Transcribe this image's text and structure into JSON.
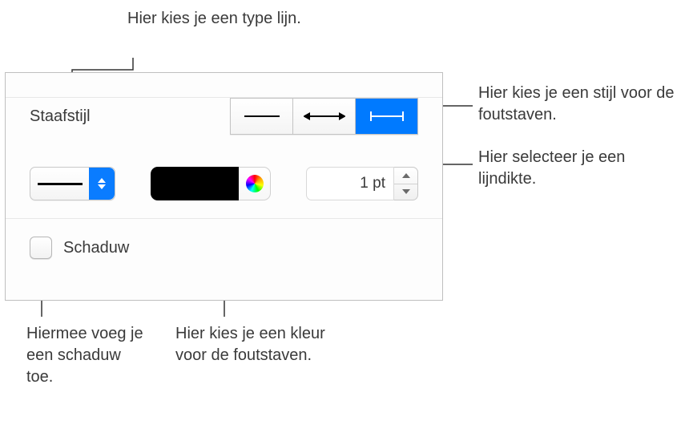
{
  "callouts": {
    "lineType": "Hier kies je een type lijn.",
    "barStyle": "Hier kies je een stijl voor de foutstaven.",
    "lineWeight": "Hier selecteer je een lijndikte.",
    "shadow": "Hiermee voeg je een schaduw toe.",
    "barColor": "Hier kies je een kleur voor de foutstaven."
  },
  "panel": {
    "sectionTitle": "Staafstijl",
    "lineWeightValue": "1 pt",
    "shadowLabel": "Schaduw",
    "colorSwatch": "#000000"
  }
}
